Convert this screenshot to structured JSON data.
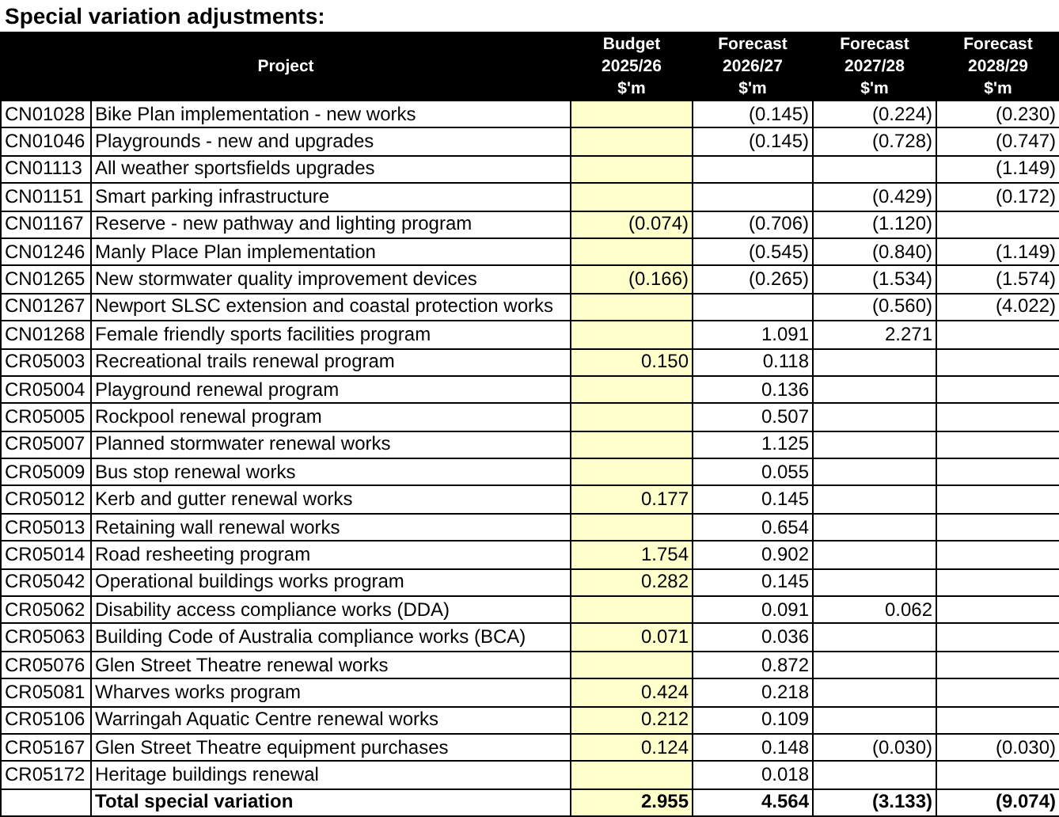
{
  "title": "Special variation adjustments:",
  "columns": [
    {
      "lines": [
        "Project"
      ]
    },
    {
      "lines": [
        "Budget",
        "2025/26",
        "$'m"
      ]
    },
    {
      "lines": [
        "Forecast",
        "2026/27",
        "$'m"
      ]
    },
    {
      "lines": [
        "Forecast",
        "2027/28",
        "$'m"
      ]
    },
    {
      "lines": [
        "Forecast",
        "2028/29",
        "$'m"
      ]
    }
  ],
  "rows": [
    {
      "code": "CN01028",
      "project": "Bike Plan implementation - new works",
      "forecast_2026_27": "(0.145)",
      "forecast_2027_28": "(0.224)",
      "forecast_2028_29": "(0.230)"
    },
    {
      "code": "CN01046",
      "project": "Playgrounds - new and upgrades",
      "forecast_2026_27": "(0.145)",
      "forecast_2027_28": "(0.728)",
      "forecast_2028_29": "(0.747)"
    },
    {
      "code": "CN01113",
      "project": "All weather sportsfields upgrades",
      "forecast_2028_29": "(1.149)"
    },
    {
      "code": "CN01151",
      "project": "Smart parking infrastructure",
      "forecast_2027_28": "(0.429)",
      "forecast_2028_29": "(0.172)"
    },
    {
      "code": "CN01167",
      "project": "Reserve - new pathway and lighting program",
      "budget_2025_26": "(0.074)",
      "forecast_2026_27": "(0.706)",
      "forecast_2027_28": "(1.120)"
    },
    {
      "code": "CN01246",
      "project": "Manly Place Plan implementation",
      "forecast_2026_27": "(0.545)",
      "forecast_2027_28": "(0.840)",
      "forecast_2028_29": "(1.149)"
    },
    {
      "code": "CN01265",
      "project": "New stormwater quality improvement devices",
      "budget_2025_26": "(0.166)",
      "forecast_2026_27": "(0.265)",
      "forecast_2027_28": "(1.534)",
      "forecast_2028_29": "(1.574)"
    },
    {
      "code": "CN01267",
      "project": "Newport SLSC extension and coastal protection works",
      "forecast_2027_28": "(0.560)",
      "forecast_2028_29": "(4.022)"
    },
    {
      "code": "CN01268",
      "project": "Female friendly sports facilities program",
      "forecast_2026_27": "1.091",
      "forecast_2027_28": "2.271"
    },
    {
      "code": "CR05003",
      "project": "Recreational trails renewal program",
      "budget_2025_26": "0.150",
      "forecast_2026_27": "0.118"
    },
    {
      "code": "CR05004",
      "project": "Playground renewal program",
      "forecast_2026_27": "0.136"
    },
    {
      "code": "CR05005",
      "project": "Rockpool renewal program",
      "forecast_2026_27": "0.507"
    },
    {
      "code": "CR05007",
      "project": "Planned stormwater renewal works",
      "forecast_2026_27": "1.125"
    },
    {
      "code": "CR05009",
      "project": "Bus stop renewal works",
      "forecast_2026_27": "0.055"
    },
    {
      "code": "CR05012",
      "project": "Kerb and gutter renewal works",
      "budget_2025_26": "0.177",
      "forecast_2026_27": "0.145"
    },
    {
      "code": "CR05013",
      "project": "Retaining wall renewal works",
      "forecast_2026_27": "0.654"
    },
    {
      "code": "CR05014",
      "project": "Road resheeting program",
      "budget_2025_26": "1.754",
      "forecast_2026_27": "0.902"
    },
    {
      "code": "CR05042",
      "project": "Operational buildings works program",
      "budget_2025_26": "0.282",
      "forecast_2026_27": "0.145"
    },
    {
      "code": "CR05062",
      "project": "Disability access compliance works (DDA)",
      "forecast_2026_27": "0.091",
      "forecast_2027_28": "0.062"
    },
    {
      "code": "CR05063",
      "project": "Building Code of Australia compliance works (BCA)",
      "budget_2025_26": "0.071",
      "forecast_2026_27": "0.036"
    },
    {
      "code": "CR05076",
      "project": "Glen Street Theatre renewal works",
      "forecast_2026_27": "0.872"
    },
    {
      "code": "CR05081",
      "project": "Wharves works program",
      "budget_2025_26": "0.424",
      "forecast_2026_27": "0.218"
    },
    {
      "code": "CR05106",
      "project": "Warringah Aquatic Centre renewal works",
      "budget_2025_26": "0.212",
      "forecast_2026_27": "0.109"
    },
    {
      "code": "CR05167",
      "project": "Glen Street Theatre equipment purchases",
      "budget_2025_26": "0.124",
      "forecast_2026_27": "0.148",
      "forecast_2027_28": "(0.030)",
      "forecast_2028_29": "(0.030)"
    },
    {
      "code": "CR05172",
      "project": "Heritage buildings renewal",
      "forecast_2026_27": "0.018"
    }
  ],
  "total": {
    "label": "Total special variation",
    "budget_2025_26": "2.955",
    "forecast_2026_27": "4.564",
    "forecast_2027_28": "(3.133)",
    "forecast_2028_29": "(9.074)"
  }
}
